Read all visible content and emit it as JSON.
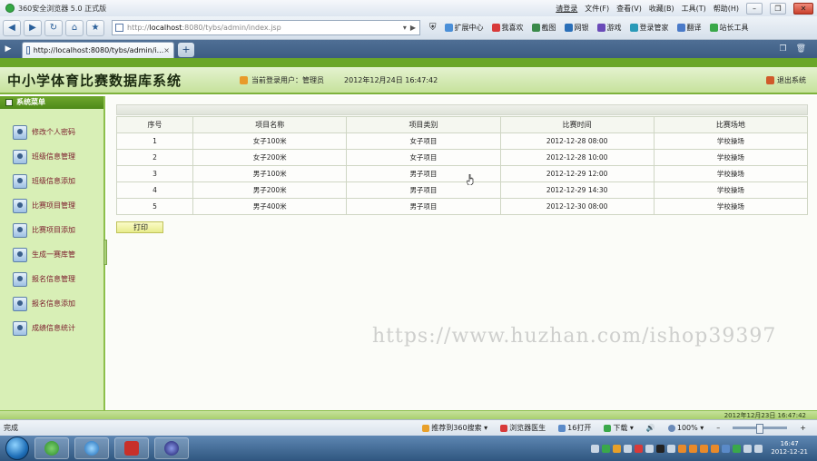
{
  "browser": {
    "title": "360安全浏览器 5.0 正式版",
    "login_link": "请登录",
    "menu": [
      "文件(F)",
      "查看(V)",
      "收藏(B)",
      "工具(T)",
      "帮助(H)"
    ],
    "url_prefix": "http://",
    "url_host": "localhost",
    "url_rest": ":8080/tybs/admin/index.jsp",
    "toolbar": [
      "扩展中心",
      "我喜欢",
      "截图",
      "网银",
      "游戏",
      "登录管家",
      "翻译",
      "站长工具"
    ],
    "tab_title": "http://localhost:8080/tybs/admin/i...",
    "tab_close": "×",
    "new_tab": "+"
  },
  "app": {
    "system_name": "中小学体育比赛数据库系统",
    "current_user_label": "当前登录用户：管理员",
    "datetime": "2012年12月24日  16:47:42",
    "logout": "退出系统",
    "menu_title": "系统菜单",
    "menu_items": [
      "修改个人密码",
      "班级信息管理",
      "班级信息添加",
      "比赛项目管理",
      "比赛项目添加",
      "生成一赛库管",
      "报名信息管理",
      "报名信息添加",
      "成绩信息统计"
    ],
    "footer_datetime": "2012年12月23日  16:47:42"
  },
  "table": {
    "columns": [
      "序号",
      "项目名称",
      "项目类别",
      "比赛时间",
      "比赛场地"
    ],
    "rows": [
      [
        "1",
        "女子100米",
        "女子项目",
        "2012-12-28 08:00",
        "学校操场"
      ],
      [
        "2",
        "女子200米",
        "女子项目",
        "2012-12-28 10:00",
        "学校操场"
      ],
      [
        "3",
        "男子100米",
        "男子项目",
        "2012-12-29 12:00",
        "学校操场"
      ],
      [
        "4",
        "男子200米",
        "男子项目",
        "2012-12-29 14:30",
        "学校操场"
      ],
      [
        "5",
        "男子400米",
        "男子项目",
        "2012-12-30 08:00",
        "学校操场"
      ]
    ],
    "print_button": "打印"
  },
  "watermark": "https://www.huzhan.com/ishop39397",
  "statusbar": {
    "done": "完成",
    "recommend": "推荐到360搜索",
    "doctor": "浏览器医生",
    "opened": "16打开",
    "download": "下载",
    "zoom": "100%"
  },
  "taskbar": {
    "clock_time": "16:47",
    "clock_date": "2012-12-21"
  },
  "colors": {
    "header_green": "#c6e29c",
    "menu_head_green": "#4e8a19",
    "sidebar_bg": "#d8efb6",
    "menu_text": "#7a1a2a"
  }
}
